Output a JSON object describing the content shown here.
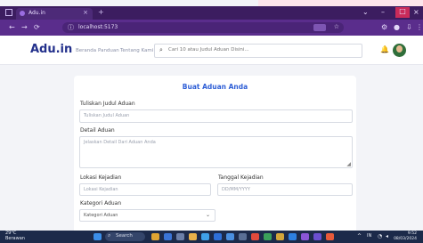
{
  "browser": {
    "tab_title": "Adu.in",
    "tab_close": "×",
    "new_tab": "+",
    "url": "localhost:5173",
    "win_min": "–",
    "win_max": "□",
    "win_close": "×",
    "back": "←",
    "forward": "→",
    "reload": "⟳",
    "info_icon": "ⓘ",
    "star_icon": "☆",
    "ext_icon": "⚙",
    "menu_icon": "⋮"
  },
  "header": {
    "brand": "Adu.in",
    "nav": [
      "Beranda",
      "Panduan",
      "Tentang Kami"
    ],
    "search_placeholder": "Cari 10 atau Judul Aduan Disini...",
    "search_icon": "⌕",
    "bell_icon": "🔔"
  },
  "form": {
    "title": "Buat Aduan Anda",
    "title_label": "Tuliskan Judul Aduan",
    "title_placeholder": "Tuliskan Judul Aduan",
    "detail_label": "Detail Aduan",
    "detail_placeholder": "Jelaskan Detail Dari Aduan Anda",
    "location_label": "Lokasi Kejadian",
    "location_placeholder": "Lokasi Kejadian",
    "date_label": "Tanggal Kejadian",
    "date_placeholder": "DD/MM/YYYY",
    "category_label": "Kategori Aduan",
    "category_value": "Kategori Aduan",
    "category_caret": "⌄"
  },
  "taskbar": {
    "weather_temp": "29°C",
    "weather_text": "Berawan",
    "search_text": "Search",
    "search_icon": "⌕",
    "time": "9:52",
    "date": "08/03/2024",
    "tray_up": "^",
    "tray_lang": "IN",
    "tray_wifi": "◔"
  },
  "colors": {
    "brand": "#24318c",
    "accent": "#2f5fd6",
    "browser_chrome": "#5a2d8c"
  }
}
